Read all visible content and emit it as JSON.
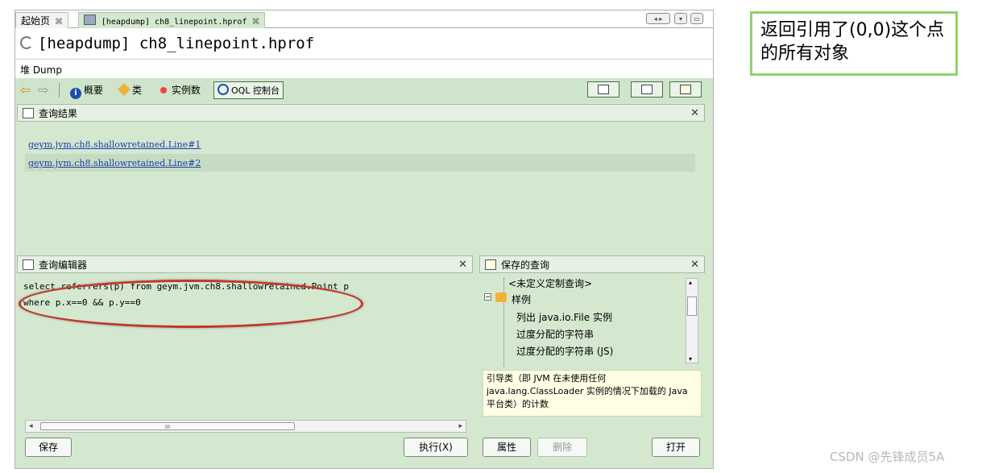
{
  "tabs": [
    {
      "label": "起始页",
      "close": "⌘"
    },
    {
      "label": "[heapdump] ch8_linepoint.hprof",
      "close": "⌘"
    }
  ],
  "title": "[heapdump] ch8_linepoint.hprof",
  "dump_label": "堆 Dump",
  "toolbar": {
    "summary": "概要",
    "classes": "类",
    "instances": "实例数",
    "oql": "OQL 控制台"
  },
  "results": {
    "title": "查询结果",
    "items": [
      "geym.jvm.ch8.shallowretained.Line#1",
      "geym.jvm.ch8.shallowretained.Line#2"
    ]
  },
  "editor": {
    "title": "查询编辑器",
    "line1": "select referrers(p) from geym.jvm.ch8.shallowretained.Point p",
    "line2": "where p.x==0 && p.y==0",
    "scroll_mark": "III",
    "save": "保存",
    "run": "执行(X)"
  },
  "saved": {
    "title": "保存的查询",
    "tree": [
      "<未定义定制查询>",
      "样例",
      "列出 java.io.File 实例",
      "过度分配的字符串",
      "过度分配的字符串 (JS)"
    ],
    "desc": "引导类（即 JVM 在未使用任何 java.lang.ClassLoader 实例的情况下加载的 Java 平台类）的计数",
    "props": "属性",
    "delete": "删除",
    "open": "打开"
  },
  "annotation": "返回引用了(0,0)这个点的所有对象",
  "footer": "CSDN @先锋成员5A",
  "colors": {
    "panel_bg": "#d4e8d0",
    "highlight_ellipse": "#c0392b",
    "annotation_border": "#8fd36a",
    "link": "#1a3fb0"
  }
}
